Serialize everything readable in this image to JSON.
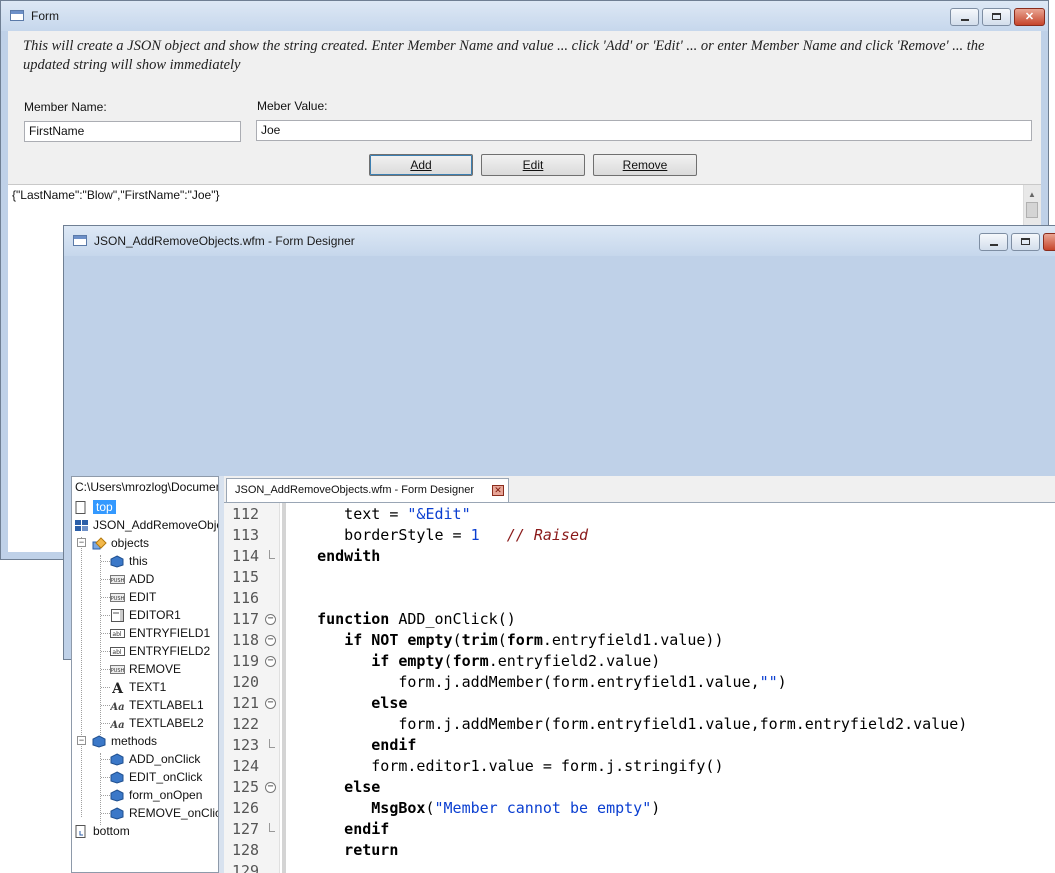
{
  "form_window": {
    "title": "Form",
    "description": "This will create a JSON object and show the string created. Enter Member Name and value ... click 'Add' or 'Edit' ... or enter Member Name and click 'Remove' ... the updated string will show immediately",
    "member_name_label": "Member Name:",
    "member_name_value": "FirstName",
    "member_value_label": "Meber Value:",
    "member_value_value": "Joe",
    "buttons": {
      "add": "Add",
      "edit": "Edit",
      "remove": "Remove"
    },
    "editor_text": "{\"LastName\":\"Blow\",\"FirstName\":\"Joe\"}"
  },
  "designer_window": {
    "title": "JSON_AddRemoveObjects.wfm - Form Designer",
    "tab_label": "JSON_AddRemoveObjects.wfm - Form Designer",
    "tree": {
      "path": "C:\\Users\\mrozlog\\Documents",
      "root": "top",
      "file": "JSON_AddRemoveObjects.wfm",
      "objects_label": "objects",
      "objects": [
        "this",
        "ADD",
        "EDIT",
        "EDITOR1",
        "ENTRYFIELD1",
        "ENTRYFIELD2",
        "REMOVE",
        "TEXT1",
        "TEXTLABEL1",
        "TEXTLABEL2"
      ],
      "methods_label": "methods",
      "methods": [
        "ADD_onClick",
        "EDIT_onClick",
        "form_onOpen",
        "REMOVE_onClick"
      ],
      "bottom": "bottom"
    },
    "code_lines": [
      {
        "n": "112",
        "fold": "",
        "segs": [
          [
            "p",
            "      text = "
          ],
          [
            "s",
            "\"&Edit\""
          ]
        ]
      },
      {
        "n": "113",
        "fold": "",
        "segs": [
          [
            "p",
            "      borderStyle = "
          ],
          [
            "s",
            "1"
          ],
          [
            "p",
            "   "
          ],
          [
            "c",
            "// Raised"
          ]
        ]
      },
      {
        "n": "114",
        "fold": "end",
        "segs": [
          [
            "k",
            "   endwith"
          ]
        ]
      },
      {
        "n": "115",
        "fold": "",
        "segs": []
      },
      {
        "n": "116",
        "fold": "",
        "segs": []
      },
      {
        "n": "117",
        "fold": "open",
        "segs": [
          [
            "p",
            "   "
          ],
          [
            "k",
            "function"
          ],
          [
            "p",
            " ADD_onClick()"
          ]
        ]
      },
      {
        "n": "118",
        "fold": "open",
        "segs": [
          [
            "p",
            "      "
          ],
          [
            "k",
            "if NOT empty"
          ],
          [
            "p",
            "("
          ],
          [
            "k",
            "trim"
          ],
          [
            "p",
            "("
          ],
          [
            "k",
            "form"
          ],
          [
            "p",
            ".entryfield1.value))"
          ]
        ]
      },
      {
        "n": "119",
        "fold": "open",
        "segs": [
          [
            "p",
            "         "
          ],
          [
            "k",
            "if empty"
          ],
          [
            "p",
            "("
          ],
          [
            "k",
            "form"
          ],
          [
            "p",
            ".entryfield2.value)"
          ]
        ]
      },
      {
        "n": "120",
        "fold": "",
        "segs": [
          [
            "p",
            "            form.j.addMember(form.entryfield1.value,"
          ],
          [
            "s",
            "\"\""
          ],
          [
            "p",
            ")"
          ]
        ]
      },
      {
        "n": "121",
        "fold": "open",
        "segs": [
          [
            "k",
            "         else"
          ]
        ]
      },
      {
        "n": "122",
        "fold": "",
        "segs": [
          [
            "p",
            "            form.j.addMember(form.entryfield1.value,form.entryfield2.value)"
          ]
        ]
      },
      {
        "n": "123",
        "fold": "end",
        "segs": [
          [
            "k",
            "         endif"
          ]
        ]
      },
      {
        "n": "124",
        "fold": "",
        "segs": [
          [
            "p",
            "         form.editor1.value = form.j.stringify()"
          ]
        ]
      },
      {
        "n": "125",
        "fold": "open",
        "segs": [
          [
            "k",
            "      else"
          ]
        ]
      },
      {
        "n": "126",
        "fold": "",
        "segs": [
          [
            "p",
            "         "
          ],
          [
            "k",
            "MsgBox"
          ],
          [
            "p",
            "("
          ],
          [
            "s",
            "\"Member cannot be empty\""
          ],
          [
            "p",
            ")"
          ]
        ]
      },
      {
        "n": "127",
        "fold": "end",
        "segs": [
          [
            "k",
            "      endif"
          ]
        ]
      },
      {
        "n": "128",
        "fold": "",
        "segs": [
          [
            "k",
            "      return"
          ]
        ]
      },
      {
        "n": "129",
        "fold": "",
        "segs": []
      }
    ]
  }
}
